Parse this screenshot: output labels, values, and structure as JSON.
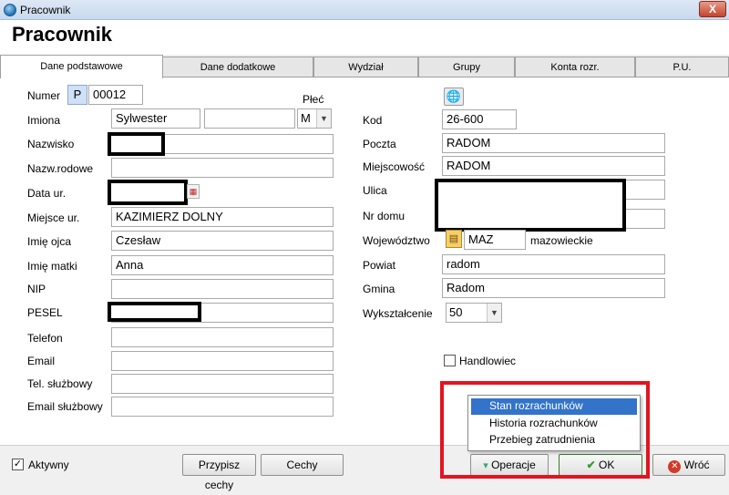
{
  "window": {
    "title": "Pracownik",
    "close_symbol": "X"
  },
  "header": {
    "title": "Pracownik"
  },
  "tabs": [
    {
      "label": "Dane podstawowe",
      "active": true
    },
    {
      "label": "Dane dodatkowe"
    },
    {
      "label": "Wydział"
    },
    {
      "label": "Grupy"
    },
    {
      "label": "Konta rozr."
    },
    {
      "label": "P.U."
    }
  ],
  "form_left": {
    "numer": {
      "label": "Numer",
      "prefix": "P",
      "value": "00012"
    },
    "plec": {
      "label": "Płeć",
      "value": "M"
    },
    "imiona": {
      "label": "Imiona",
      "value": "Sylwester",
      "value2": ""
    },
    "nazwisko": {
      "label": "Nazwisko",
      "value": ""
    },
    "nazw_rodowe": {
      "label": "Nazw.rodowe",
      "value": ""
    },
    "data_ur": {
      "label": "Data ur.",
      "value": ""
    },
    "miejsce_ur": {
      "label": "Miejsce ur.",
      "value": "KAZIMIERZ DOLNY"
    },
    "imie_ojca": {
      "label": "Imię ojca",
      "value": "Czesław"
    },
    "imie_matki": {
      "label": "Imię matki",
      "value": "Anna"
    },
    "nip": {
      "label": "NIP",
      "value": ""
    },
    "pesel": {
      "label": "PESEL",
      "value": ""
    },
    "telefon": {
      "label": "Telefon",
      "value": ""
    },
    "email": {
      "label": "Email",
      "value": ""
    },
    "tel_sluzbowy": {
      "label": "Tel. służbowy",
      "value": ""
    },
    "email_sluzbowy": {
      "label": "Email służbowy",
      "value": ""
    }
  },
  "form_right": {
    "kod": {
      "label": "Kod",
      "value": "26-600"
    },
    "poczta": {
      "label": "Poczta",
      "value": "RADOM"
    },
    "miejscowosc": {
      "label": "Miejscowość",
      "value": "RADOM"
    },
    "ulica": {
      "label": "Ulica",
      "value": ""
    },
    "nr_domu": {
      "label": "Nr domu",
      "value": ""
    },
    "wojewodztwo": {
      "label": "Województwo",
      "code": "MAZ",
      "name": "mazowieckie"
    },
    "powiat": {
      "label": "Powiat",
      "value": "radom"
    },
    "gmina": {
      "label": "Gmina",
      "value": "Radom"
    },
    "wyksztalcenie": {
      "label": "Wykształcenie",
      "value": "50"
    },
    "handlowiec": {
      "label": "Handlowiec",
      "checked": false
    }
  },
  "footer": {
    "aktywny": {
      "label": "Aktywny",
      "checked": true
    },
    "przypisz_cechy": "Przypisz cechy",
    "cechy": "Cechy",
    "operacje": "Operacje",
    "ok": "OK",
    "wroc": "Wróć"
  },
  "operacje_menu": {
    "items": [
      "Stan rozrachunków",
      "Historia rozrachunków",
      "Przebieg zatrudnienia"
    ],
    "highlighted_index": 0
  },
  "colors": {
    "highlight_frame": "#e3141f",
    "menu_highlight": "#3373c9"
  }
}
